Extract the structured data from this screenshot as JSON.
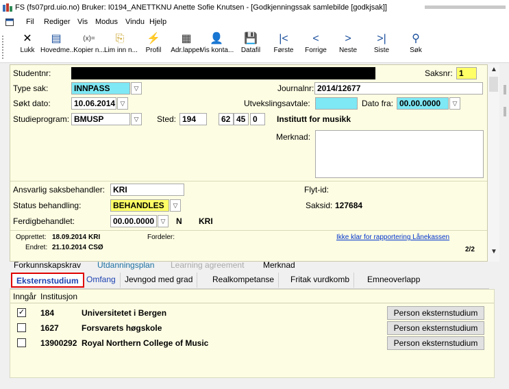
{
  "window": {
    "title": "FS (fs07prd.uio.no) Bruker: I0194_ANETTKNU Anette Sofie Knutsen - [Godkjenningssak samlebilde  [godkjsak]]"
  },
  "menu": [
    "Fil",
    "Rediger",
    "Vis",
    "Modus",
    "Vindu",
    "Hjelp"
  ],
  "toolbar": [
    {
      "icon": "close-icon",
      "glyph": "✕",
      "label": "Lukk",
      "color": "#000000"
    },
    {
      "icon": "window-icon",
      "glyph": "▤",
      "label": "Hovedme...",
      "color": "#1a4f9c"
    },
    {
      "icon": "copy-icon",
      "glyph": "(x)=",
      "label": "Kopier n...",
      "color": "#333333"
    },
    {
      "icon": "paste-icon",
      "glyph": "⎘",
      "label": "Lim inn n...",
      "color": "#c9a227"
    },
    {
      "icon": "lightning-icon",
      "glyph": "⚡",
      "label": "Profil",
      "color": "#f0b400"
    },
    {
      "icon": "labels-icon",
      "glyph": "▦",
      "label": "Adr.lapper",
      "color": "#333333"
    },
    {
      "icon": "person-icon",
      "glyph": "👤",
      "label": "Vis konta...",
      "color": "#d6a100"
    },
    {
      "icon": "disk-icon",
      "glyph": "💾",
      "label": "Datafil",
      "color": "#1a4f9c"
    },
    {
      "icon": "first-icon",
      "glyph": "|<",
      "label": "Første",
      "color": "#1a4f9c"
    },
    {
      "icon": "prev-icon",
      "glyph": "<",
      "label": "Forrige",
      "color": "#1a4f9c"
    },
    {
      "icon": "next-icon",
      "glyph": ">",
      "label": "Neste",
      "color": "#1a4f9c"
    },
    {
      "icon": "last-icon",
      "glyph": ">|",
      "label": "Siste",
      "color": "#1a4f9c"
    },
    {
      "icon": "search-icon",
      "glyph": "⚲",
      "label": "Søk",
      "color": "#1a4f9c"
    }
  ],
  "form": {
    "studentnr_label": "Studentnr:",
    "saksnr_label": "Saksnr:",
    "saksnr_value": "1",
    "type_sak_label": "Type sak:",
    "type_sak_value": "INNPASS",
    "journalnr_label": "Journalnr:",
    "journalnr_value": "2014/12677",
    "sokt_dato_label": "Søkt dato:",
    "sokt_dato_value": "10.06.2014",
    "utveksling_label": "Utvekslingsavtale:",
    "dato_fra_label": "Dato fra:",
    "dato_fra_value": "00.00.0000",
    "studieprogram_label": "Studieprogram:",
    "studieprogram_value": "BMUSP",
    "sted_label": "Sted:",
    "sted_1": "194",
    "sted_2": "62",
    "sted_3": "45",
    "sted_4": "0",
    "sted_name": "Institutt for musikk",
    "merknad_label": "Merknad:",
    "ansvarlig_label": "Ansvarlig saksbehandler:",
    "ansvarlig_value": "KRI",
    "flyt_label": "Flyt-id:",
    "status_label": "Status behandling:",
    "status_value": "BEHANDLES",
    "saksid_label": "Saksid:",
    "saksid_value": "127684",
    "ferdig_label": "Ferdigbehandlet:",
    "ferdig_value": "00.00.0000",
    "ferdig_flag": "N",
    "ferdig_user": "KRI",
    "opprettet_label": "Opprettet:",
    "opprettet_date": "18.09.2014",
    "opprettet_user": "KRI",
    "fordeler_label": "Fordeler:",
    "endret_label": "Endret:",
    "endret_date": "21.10.2014",
    "endret_user": "CSØ",
    "lanekassen_link": "Ikke klar for rapportering Lånekassen",
    "page_counter": "2/2"
  },
  "tabs_top": [
    "Forkunnskapskrav",
    "Utdanningsplan",
    "Learning agreement",
    "Merknad"
  ],
  "tabs_sub": [
    "Eksternstudium",
    "Omfang",
    "Jevngod med grad",
    "Realkompetanse",
    "Fritak vurdkomb",
    "Emneoverlapp"
  ],
  "table": {
    "col_ingar": "Inngår",
    "col_institusjon": "Institusjon",
    "rows": [
      {
        "checked": true,
        "code": "184",
        "name": "Universitetet i Bergen",
        "button": "Person eksternstudium"
      },
      {
        "checked": false,
        "code": "1627",
        "name": "Forsvarets høgskole",
        "button": "Person eksternstudium"
      },
      {
        "checked": false,
        "code": "13900292",
        "name": "Royal Northern College of Music",
        "button": "Person eksternstudium"
      }
    ]
  },
  "colors": {
    "form_bg": "#fdfde3",
    "cyan_field": "#7ee8f4",
    "yellow_field": "#ffff66",
    "active_tab_border": "#e00000",
    "link": "#0033cc"
  }
}
